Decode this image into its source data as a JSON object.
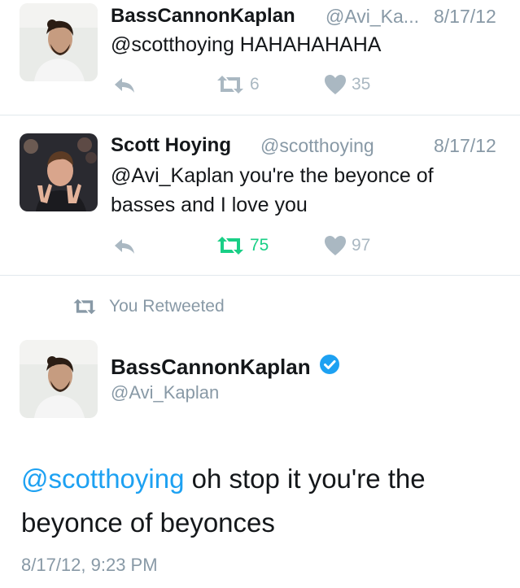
{
  "tweets": [
    {
      "name": "BassCannonKaplan",
      "handle": "@Avi_Ka...",
      "date": "8/17/12",
      "text": "@scotthoying HAHAHAHAHA",
      "retweets": "6",
      "likes": "35"
    },
    {
      "name": "Scott Hoying",
      "handle": "@scotthoying",
      "date": "8/17/12",
      "text": "@Avi_Kaplan you're the beyonce of basses and I love you",
      "retweets": "75",
      "likes": "97"
    }
  ],
  "focused": {
    "retweet_banner": "You Retweeted",
    "name": "BassCannonKaplan",
    "handle": "@Avi_Kaplan",
    "mention": "@scotthoying",
    "text": " oh stop it you're the beyonce of beyonces",
    "timestamp": "8/17/12, 9:23 PM"
  },
  "colors": {
    "retweet_active": "#19cf86",
    "link": "#1da1f2",
    "secondary": "#8899a6",
    "icon": "#aab8c2",
    "verified": "#1da1f2"
  },
  "icons": [
    "reply-icon",
    "retweet-icon",
    "heart-icon",
    "verified-icon"
  ]
}
